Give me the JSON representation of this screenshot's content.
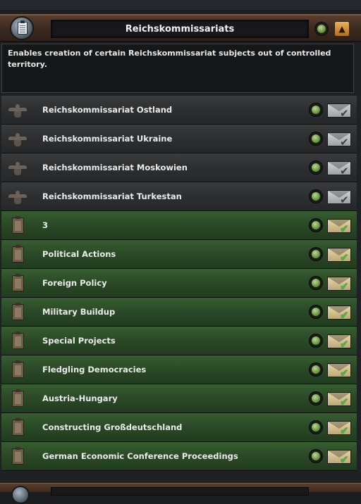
{
  "header": {
    "title": "Reichskommissariats",
    "icon": "clipboard-icon",
    "collapse_icon": "chevron-up-icon"
  },
  "description": "Enables creation of certain Reichskommissariat subjects out of controlled territory.",
  "colors": {
    "active_row": "#2b4a27",
    "inactive_row": "#2d2f31",
    "status_dot": "#5d8c32",
    "checkmark": "#3fbf3b"
  },
  "rules": [
    {
      "label": "Reichskommissariat Ostland",
      "icon": "eagle-icon",
      "state": "grey"
    },
    {
      "label": "Reichskommissariat Ukraine",
      "icon": "eagle-icon",
      "state": "grey"
    },
    {
      "label": "Reichskommissariat Moskowien",
      "icon": "eagle-icon",
      "state": "grey"
    },
    {
      "label": "Reichskommissariat Turkestan",
      "icon": "eagle-icon",
      "state": "grey"
    },
    {
      "label": "3",
      "icon": "clipboard-icon",
      "state": "green"
    },
    {
      "label": "Political Actions",
      "icon": "clipboard-icon",
      "state": "green"
    },
    {
      "label": "Foreign Policy",
      "icon": "clipboard-icon",
      "state": "green"
    },
    {
      "label": "Military Buildup",
      "icon": "clipboard-icon",
      "state": "green"
    },
    {
      "label": "Special Projects",
      "icon": "clipboard-icon",
      "state": "green"
    },
    {
      "label": "Fledgling Democracies",
      "icon": "clipboard-icon",
      "state": "green"
    },
    {
      "label": "Austria-Hungary",
      "icon": "clipboard-icon",
      "state": "green"
    },
    {
      "label": "Constructing Großdeutschland",
      "icon": "clipboard-icon",
      "state": "green"
    },
    {
      "label": "German Economic Conference Proceedings",
      "icon": "clipboard-icon",
      "state": "green"
    }
  ]
}
